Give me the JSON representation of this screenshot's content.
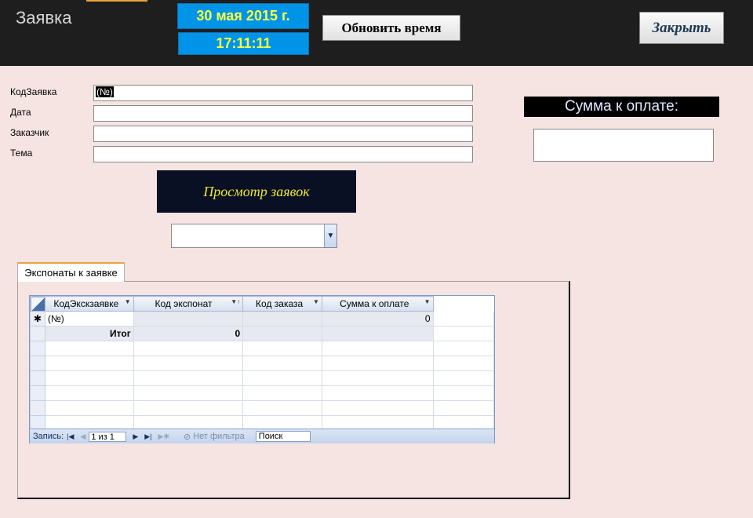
{
  "header": {
    "title": "Заявка",
    "date": "30 мая 2015 г.",
    "time": "17:11:11",
    "refresh_button": "Обновить время",
    "close_button": "Закрыть"
  },
  "form": {
    "fields": [
      {
        "label": "КодЗаявка",
        "value": "(№)"
      },
      {
        "label": "Дата",
        "value": ""
      },
      {
        "label": "Заказчик",
        "value": ""
      },
      {
        "label": "Тема",
        "value": ""
      }
    ],
    "view_button": "Просмотр заявок",
    "combo_value": "",
    "sum_label": "Сумма к оплате:",
    "sum_value": ""
  },
  "subform": {
    "tab_label": "Экспонаты к заявке",
    "columns": [
      "КодЭкскзаявке",
      "Код экспонат",
      "Код заказа",
      "Сумма к оплате"
    ],
    "new_row": {
      "selector": "✱",
      "cells": [
        "(№)",
        "",
        "",
        "0"
      ]
    },
    "total_row": {
      "cells": [
        "Итог",
        "0",
        "",
        ""
      ]
    },
    "navigation": {
      "label": "Запись:",
      "position": "1 из 1",
      "filter": "Нет фильтра",
      "search": "Поиск"
    }
  },
  "colors": {
    "background": "#f5e4e2",
    "header": "#1e1e1e",
    "date_time_bg": "#0094e8",
    "date_time_text": "#ffff3b",
    "view_button_bg": "#0a1024",
    "view_button_text": "#f0ea2a"
  }
}
